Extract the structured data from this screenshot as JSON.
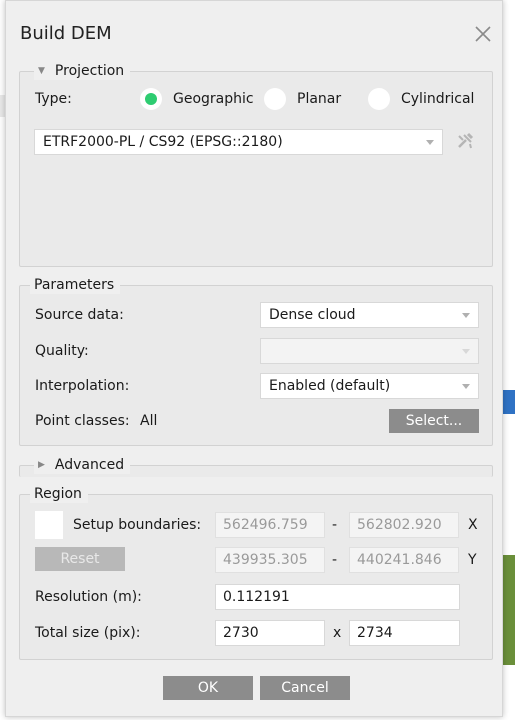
{
  "dialog": {
    "title": "Build DEM",
    "close_icon": "close-icon"
  },
  "projection": {
    "legend": "Projection",
    "type_label": "Type:",
    "options": [
      {
        "label": "Geographic",
        "selected": true
      },
      {
        "label": "Planar",
        "selected": false
      },
      {
        "label": "Cylindrical",
        "selected": false
      }
    ],
    "crs_value": "ETRF2000-PL / CS92 (EPSG::2180)",
    "crs_tool_icon": "tools-icon"
  },
  "parameters": {
    "legend": "Parameters",
    "source_label": "Source data:",
    "source_value": "Dense cloud",
    "quality_label": "Quality:",
    "quality_value": "",
    "interpolation_label": "Interpolation:",
    "interpolation_value": "Enabled (default)",
    "point_classes_label": "Point classes:",
    "point_classes_value": "All",
    "select_button": "Select..."
  },
  "advanced": {
    "legend": "Advanced"
  },
  "region": {
    "legend": "Region",
    "setup_label": "Setup boundaries:",
    "x_min": "562496.759",
    "x_max": "562802.920",
    "x_axis": "X",
    "reset_button": "Reset",
    "y_min": "439935.305",
    "y_max": "440241.846",
    "y_axis": "Y",
    "dash": "-",
    "resolution_label": "Resolution (m):",
    "resolution_value": "0.112191",
    "total_size_label": "Total size (pix):",
    "total_width": "2730",
    "times": "x",
    "total_height": "2734"
  },
  "footer": {
    "ok_button": "OK",
    "cancel_button": "Cancel"
  },
  "colors": {
    "radio_selected": "#2ecc71",
    "button_gray": "#8c8c8c"
  }
}
